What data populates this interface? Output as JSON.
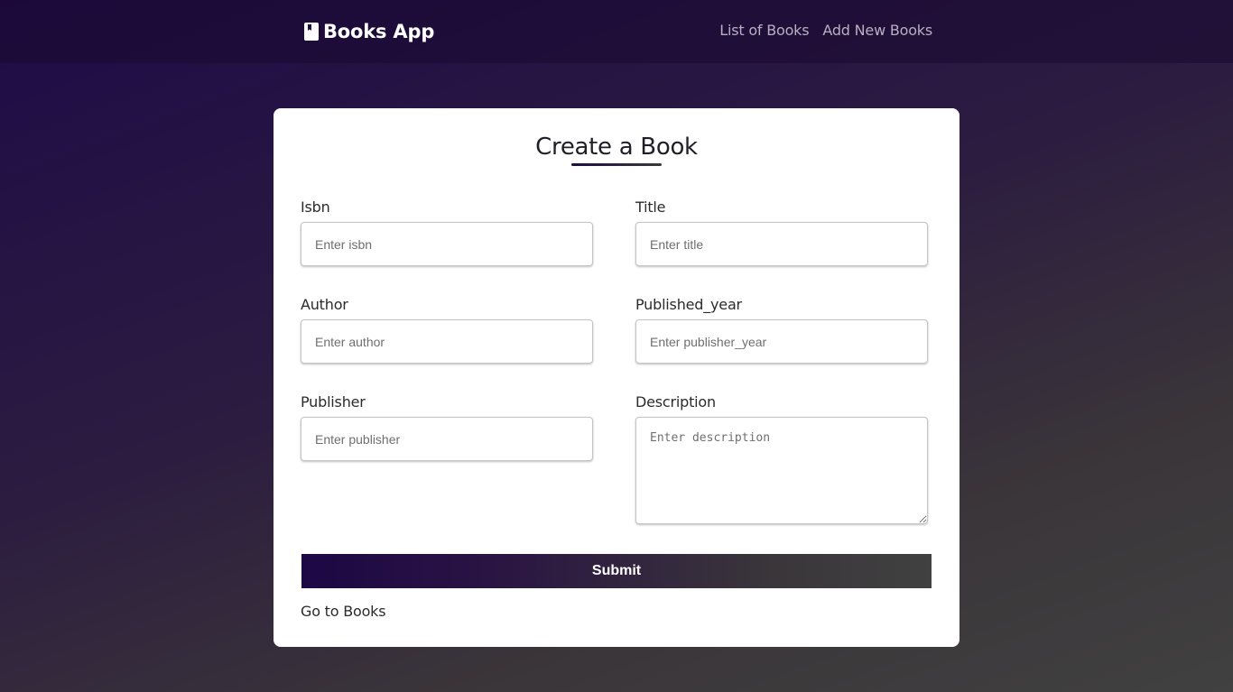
{
  "navbar": {
    "brand": "Books App",
    "links": [
      "List of Books",
      "Add New Books"
    ]
  },
  "form": {
    "title": "Create a Book",
    "fields": {
      "isbn": {
        "label": "Isbn",
        "placeholder": "Enter isbn",
        "value": ""
      },
      "title": {
        "label": "Title",
        "placeholder": "Enter title",
        "value": ""
      },
      "author": {
        "label": "Author",
        "placeholder": "Enter author",
        "value": ""
      },
      "published_year": {
        "label": "Published_year",
        "placeholder": "Enter publisher_year",
        "value": ""
      },
      "publisher": {
        "label": "Publisher",
        "placeholder": "Enter publisher",
        "value": ""
      },
      "description": {
        "label": "Description",
        "placeholder": "Enter description",
        "value": ""
      }
    },
    "submit_label": "Submit",
    "go_to_books_label": "Go to Books"
  },
  "colors": {
    "accent_dark": "#1f0b47",
    "accent_gray": "#414141",
    "card_bg": "#ffffff"
  },
  "icons": {
    "brand_icon": "book-icon"
  }
}
